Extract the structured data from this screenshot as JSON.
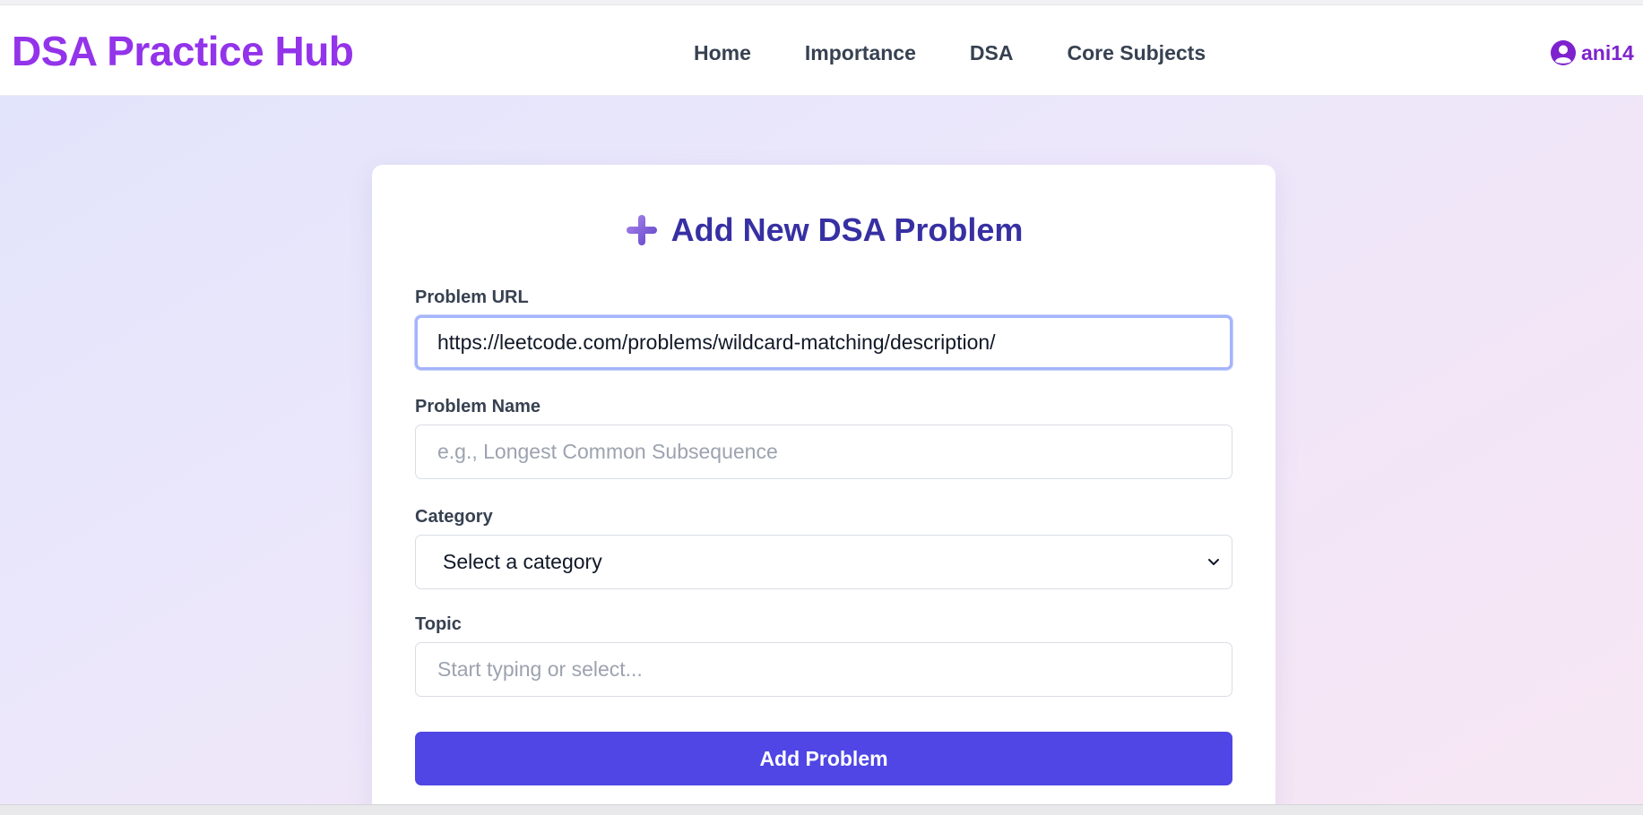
{
  "brand": "DSA Practice Hub",
  "nav": {
    "links": [
      "Home",
      "Importance",
      "DSA",
      "Core Subjects"
    ],
    "user": "ani14"
  },
  "form": {
    "title": "Add New DSA Problem",
    "url_label": "Problem URL",
    "url_value": "https://leetcode.com/problems/wildcard-matching/description/",
    "name_label": "Problem Name",
    "name_placeholder": "e.g., Longest Common Subsequence",
    "category_label": "Category",
    "category_selected": "Select a category",
    "topic_label": "Topic",
    "topic_placeholder": "Start typing or select...",
    "submit_label": "Add Problem"
  },
  "colors": {
    "brand": "#9333ea",
    "title": "#3730a3",
    "button": "#4f46e5",
    "focus_ring": "#a5b4fc"
  },
  "icons": {
    "user": "user-circle-icon",
    "title": "plus-icon",
    "select": "chevron-down-icon"
  }
}
